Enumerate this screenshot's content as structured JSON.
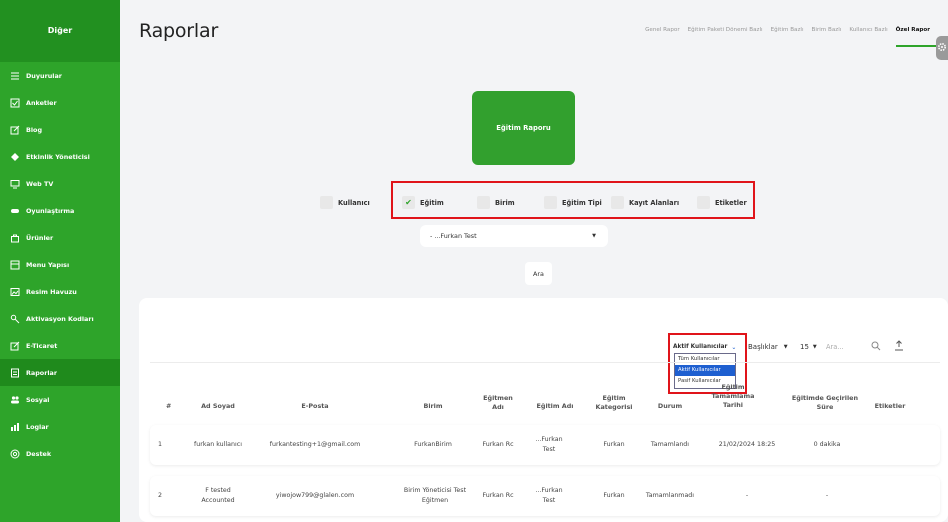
{
  "sidebar": {
    "header": "Diğer",
    "items": [
      {
        "label": "Duyurular",
        "icon": "list-icon"
      },
      {
        "label": "Anketler",
        "icon": "checkbox-icon"
      },
      {
        "label": "Blog",
        "icon": "edit-icon"
      },
      {
        "label": "Etkinlik Yöneticisi",
        "icon": "diamond-icon"
      },
      {
        "label": "Web TV",
        "icon": "monitor-icon"
      },
      {
        "label": "Oyunlaştırma",
        "icon": "gamepad-icon"
      },
      {
        "label": "Ürünler",
        "icon": "bag-icon"
      },
      {
        "label": "Menu Yapısı",
        "icon": "menu-icon"
      },
      {
        "label": "Resim Havuzu",
        "icon": "image-icon"
      },
      {
        "label": "Aktivasyon Kodları",
        "icon": "key-icon"
      },
      {
        "label": "E-Ticaret",
        "icon": "edit-icon"
      },
      {
        "label": "Raporlar",
        "icon": "report-icon"
      },
      {
        "label": "Sosyal",
        "icon": "users-icon"
      },
      {
        "label": "Loglar",
        "icon": "bar-chart-icon"
      },
      {
        "label": "Destek",
        "icon": "help-icon"
      }
    ],
    "active_index": 11
  },
  "header": {
    "title": "Raporlar",
    "tabs": [
      "Genel Rapor",
      "Eğitim Paketi Dönemi Bazlı",
      "Eğitim Bazlı",
      "Birim Bazlı",
      "Kullanıcı Bazlı",
      "Özel Rapor"
    ],
    "active_tab": "Özel Rapor"
  },
  "report_card": {
    "label": "Eğitim Raporu"
  },
  "filters": {
    "kullanici": {
      "label": "Kullanıcı",
      "checked": false
    },
    "egitim": {
      "label": "Eğitim",
      "checked": true
    },
    "birim": {
      "label": "Birim",
      "checked": false
    },
    "egitim_tipi": {
      "label": "Eğitim Tipi",
      "checked": false
    },
    "kayit_alanlari": {
      "label": "Kayıt Alanları",
      "checked": false
    },
    "etiketler": {
      "label": "Etiketler",
      "checked": false
    }
  },
  "training_select": {
    "value": "- ...Furkan Test"
  },
  "search_button": "Ara",
  "table_controls": {
    "user_filter": {
      "value": "Aktif Kullanıcılar",
      "options": [
        "Tüm Kullanıcılar",
        "Aktif Kullanıcılar",
        "Pasif Kullanıcılar"
      ],
      "selected": "Aktif Kullanıcılar"
    },
    "columns_select": "Başlıklar",
    "page_size": "15",
    "search_placeholder": "Ara..."
  },
  "table": {
    "columns": [
      "#",
      "Ad Soyad",
      "E-Posta",
      "Birim",
      "Eğitmen Adı",
      "Eğitim Adı",
      "Eğitim Kategorisi",
      "Durum",
      "Eğitim Tamamlama Tarihi",
      "Eğitimde Geçirilen Süre",
      "Etiketler"
    ],
    "rows": [
      {
        "no": "1",
        "name": "furkan kullanıcı",
        "email": "furkantesting+1@gmail.com",
        "unit": "FurkanBirim",
        "instructor": "Furkan Rc",
        "training": "...Furkan Test",
        "category": "Furkan",
        "status": "Tamamlandı",
        "date": "21/02/2024 18:25",
        "duration": "0 dakika",
        "tags": ""
      },
      {
        "no": "2",
        "name": "F tested Accounted",
        "email": "yiwojow799@glalen.com",
        "unit": "Birim Yöneticisi Test Eğitmen",
        "instructor": "Furkan Rc",
        "training": "...Furkan Test",
        "category": "Furkan",
        "status": "Tamamlanmadı",
        "date": "-",
        "duration": "-",
        "tags": ""
      }
    ]
  },
  "colors": {
    "sidebar": "#2ea42a",
    "sidebar_active": "#1f8a1c",
    "highlight": "#e0141a",
    "select_option": "#1e5fd0"
  }
}
